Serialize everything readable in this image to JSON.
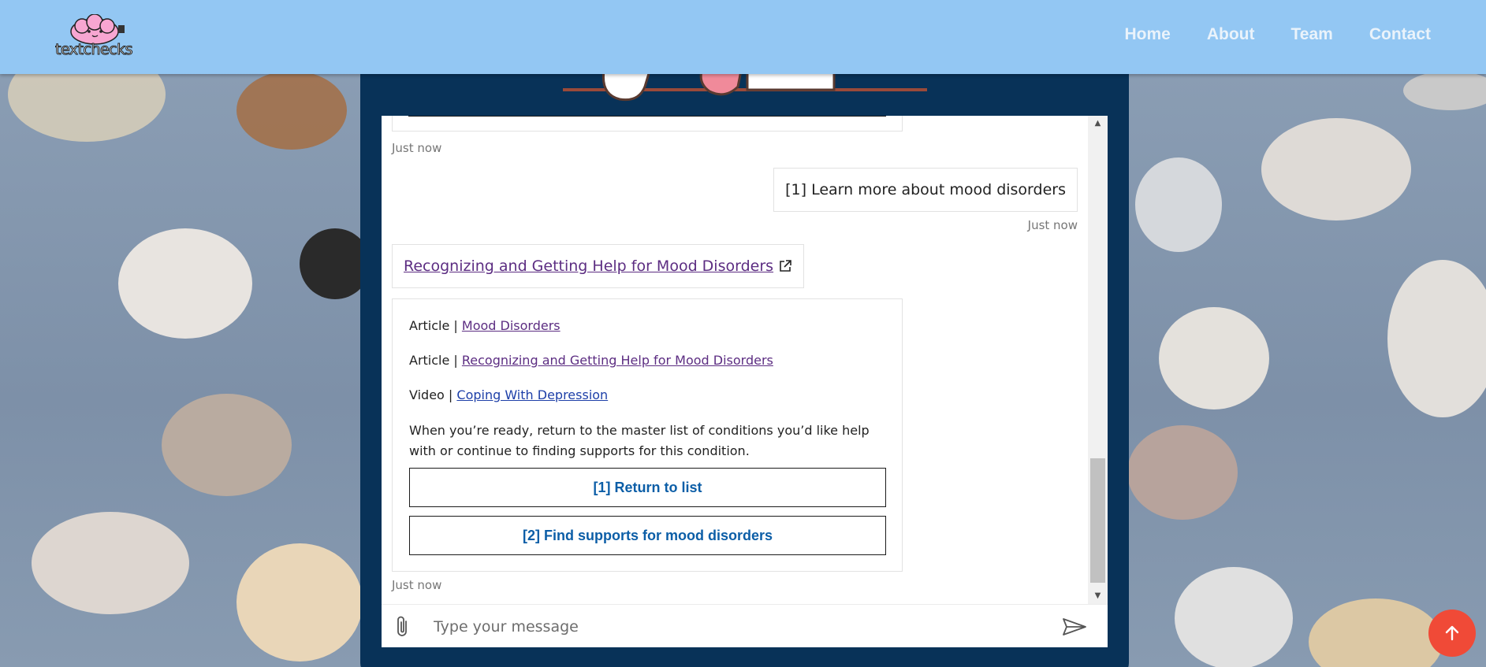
{
  "header": {
    "logo_text": "textchecks",
    "nav": [
      {
        "label": "Home"
      },
      {
        "label": "About"
      },
      {
        "label": "Team"
      },
      {
        "label": "Contact"
      }
    ]
  },
  "chat": {
    "messages": {
      "first_timestamp": "Just now",
      "user_message": "[1] Learn more about mood disorders",
      "user_timestamp": "Just now",
      "link_card_title": "Recognizing and Getting Help for Mood Disorders",
      "resources": [
        {
          "type": "Article",
          "sep": " | ",
          "title": "Mood Disorders"
        },
        {
          "type": "Article",
          "sep": " | ",
          "title": "Recognizing and Getting Help for Mood Disorders"
        },
        {
          "type": "Video",
          "sep": " | ",
          "title": "Coping With Depression"
        }
      ],
      "instruction": "When you’re ready, return to the master list of conditions you’d like help with or continue to finding supports for this condition.",
      "actions": [
        {
          "label": "[1] Return to list"
        },
        {
          "label": "[2] Find supports for mood disorders"
        }
      ],
      "bot_timestamp": "Just now"
    },
    "composer": {
      "placeholder": "Type your message"
    }
  },
  "colors": {
    "header_bg": "#93c7f3",
    "frame_bg": "#083258",
    "button_text": "#0c5ea7",
    "link_visited": "#5c2d82",
    "link_blue": "#1d3fa8",
    "fab_bg": "#f04a37"
  },
  "icons": {
    "attach": "paperclip-icon",
    "send": "send-icon",
    "external": "external-link-icon",
    "scroll_top": "arrow-up-icon"
  }
}
